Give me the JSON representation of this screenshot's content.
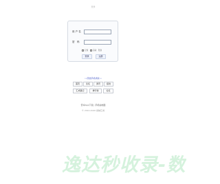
{
  "header": {
    "title": "登录"
  },
  "login": {
    "username_label": "用 户 名",
    "password_label": "密　码",
    "username_placeholder": "",
    "password_placeholder": "",
    "options": [
      "记住",
      "自动",
      "隐身"
    ],
    "login_button": "登录",
    "register_button": "注册"
  },
  "links": {
    "header": "••原始手机成版••",
    "row1": [
      "首页",
      "论坛",
      "通讯",
      "挂线"
    ],
    "row2": [
      "汇成事记",
      "排行榜",
      "论坛"
    ]
  },
  "footer": {
    "line1": "安卓App下载 | 手机站地图",
    "line2": "© 2012-2020 搜纳汇成"
  },
  "watermark": {
    "text": "逸达秒收录-数"
  }
}
